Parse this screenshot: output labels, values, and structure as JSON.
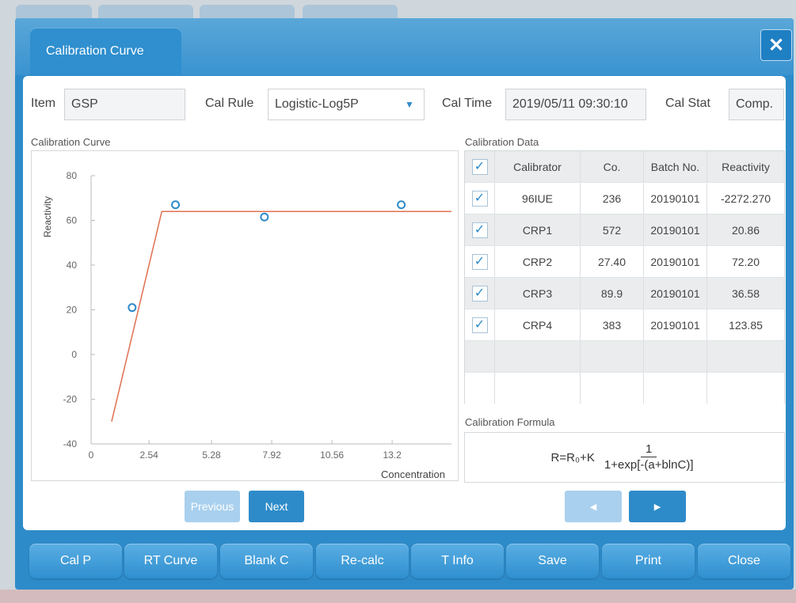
{
  "dialog": {
    "tab_title": "Calibration Curve",
    "close_icon": "close-icon"
  },
  "form": {
    "item_label": "Item",
    "item_value": "GSP",
    "cal_rule_label": "Cal Rule",
    "cal_rule_value": "Logistic-Log5P",
    "cal_time_label": "Cal Time",
    "cal_time_value": "2019/05/11 09:30:10",
    "cal_stat_label": "Cal Stat",
    "cal_stat_value": "Comp."
  },
  "sections": {
    "curve_title": "Calibration Curve",
    "data_title": "Calibration Data",
    "formula_title": "Calibration Formula"
  },
  "chart_data": {
    "type": "scatter",
    "title": "",
    "xlabel": "Concentration",
    "ylabel": "Reactivity",
    "xlim": [
      0,
      15.8
    ],
    "ylim": [
      -40,
      80
    ],
    "x_ticks": [
      "0",
      "2.54",
      "5.28",
      "7.92",
      "10.56",
      "13.2"
    ],
    "y_ticks": [
      "80",
      "60",
      "40",
      "20",
      "0",
      "-20",
      "-40"
    ],
    "points": [
      {
        "x": 1.8,
        "y": 21
      },
      {
        "x": 3.7,
        "y": 67
      },
      {
        "x": 7.6,
        "y": 61.5
      },
      {
        "x": 13.6,
        "y": 67
      }
    ],
    "curve": [
      {
        "x": 0.9,
        "y": -30
      },
      {
        "x": 3.1,
        "y": 64
      },
      {
        "x": 15.8,
        "y": 64
      }
    ],
    "colors": {
      "points": "#2e8bc9",
      "curve": "#e07050",
      "axis": "#999999"
    }
  },
  "table": {
    "headers": [
      "Calibrator",
      "Co.",
      "Batch No.",
      "Reactivity"
    ],
    "rows": [
      {
        "calibrator": "96IUE",
        "co": "236",
        "batch": "20190101",
        "reactivity": "-2272.270"
      },
      {
        "calibrator": "CRP1",
        "co": "572",
        "batch": "20190101",
        "reactivity": "20.86"
      },
      {
        "calibrator": "CRP2",
        "co": "27.40",
        "batch": "20190101",
        "reactivity": "72.20"
      },
      {
        "calibrator": "CRP3",
        "co": "89.9",
        "batch": "20190101",
        "reactivity": "36.58"
      },
      {
        "calibrator": "CRP4",
        "co": "383",
        "batch": "20190101",
        "reactivity": "123.85"
      }
    ]
  },
  "formula": {
    "lhs": "R=R₀+K",
    "numerator": "1",
    "denominator": "1+exp[-(a+blnC)]"
  },
  "nav": {
    "previous": "Previous",
    "next": "Next",
    "left_icon": "triangle-left-icon",
    "right_icon": "triangle-right-icon"
  },
  "bottom_bar": [
    "Cal P",
    "RT Curve",
    "Blank C",
    "Re-calc",
    "T Info",
    "Save",
    "Print",
    "Close"
  ]
}
